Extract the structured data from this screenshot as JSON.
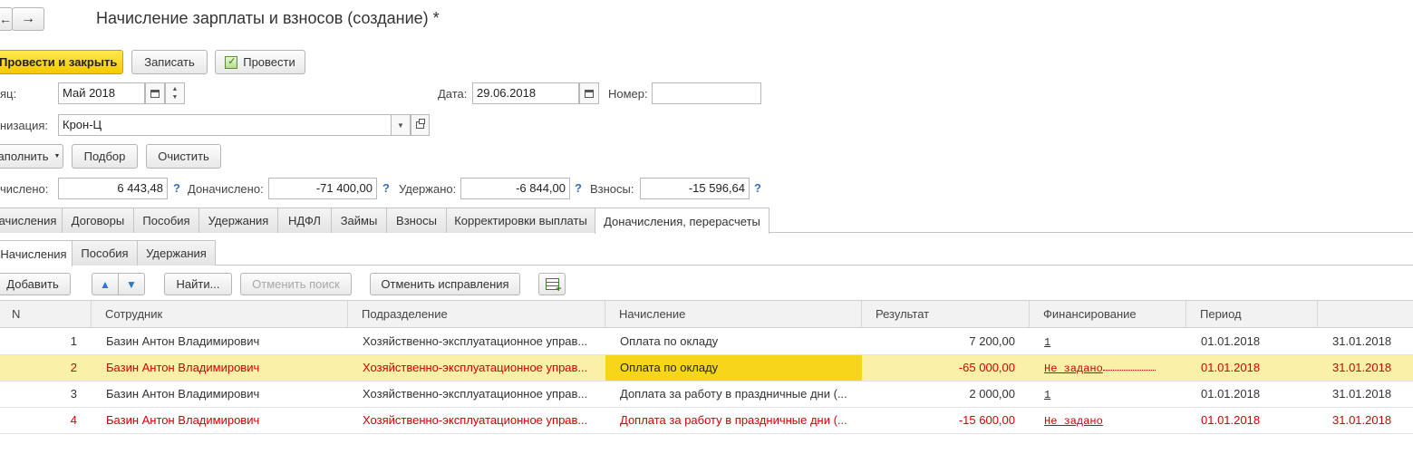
{
  "window": {
    "back_icon": "arrow-left-icon",
    "forward_icon": "arrow-right-icon",
    "title": "Начисление зарплаты и взносов (создание) *"
  },
  "toolbar": {
    "post_close_label": "Провести и закрыть",
    "save_label": "Записать",
    "post_label": "Провести"
  },
  "header": {
    "month_label": "яц:",
    "month_value": "Май 2018",
    "date_label": "Дата:",
    "date_value": "29.06.2018",
    "number_label": "Номер:",
    "number_value": "",
    "org_label": "низация:",
    "org_value": "Крон-Ц"
  },
  "actions": {
    "fill_label": "аполнить",
    "select_label": "Подбор",
    "clear_label": "Очистить"
  },
  "totals": {
    "accrued_label": "числено:",
    "accrued_value": "6 443,48",
    "additional_label": "Доначислено:",
    "additional_value": "-71 400,00",
    "withheld_label": "Удержано:",
    "withheld_value": "-6 844,00",
    "contributions_label": "Взносы:",
    "contributions_value": "-15 596,64",
    "help_mark": "?"
  },
  "tabs": [
    "ачисления",
    "Договоры",
    "Пособия",
    "Удержания",
    "НДФЛ",
    "Займы",
    "Взносы",
    "Корректировки выплаты",
    "Доначисления, перерасчеты"
  ],
  "subtabs": [
    "Начисления",
    "Пособия",
    "Удержания"
  ],
  "grid_toolbar": {
    "add_label": "Добавить",
    "find_label": "Найти...",
    "cancel_search_label": "Отменить поиск",
    "cancel_corrections_label": "Отменить исправления"
  },
  "columns": {
    "n": "N",
    "employee": "Сотрудник",
    "department": "Подразделение",
    "accrual": "Начисление",
    "result": "Результат",
    "financing": "Финансирование",
    "period": "Период"
  },
  "rows": [
    {
      "n": "1",
      "employee": "Базин Антон Владимирович",
      "department": "Хозяйственно-эксплуатационное управ...",
      "accrual": "Оплата по окладу",
      "result": "7 200,00",
      "financing": "1",
      "period_from": "01.01.2018",
      "period_to": "31.01.2018"
    },
    {
      "n": "2",
      "employee": "Базин Антон Владимирович",
      "department": "Хозяйственно-эксплуатационное управ...",
      "accrual": "Оплата по окладу",
      "result": "-65 000,00",
      "financing": "Не задано",
      "period_from": "01.01.2018",
      "period_to": "31.01.2018"
    },
    {
      "n": "3",
      "employee": "Базин Антон Владимирович",
      "department": "Хозяйственно-эксплуатационное управ...",
      "accrual": "Доплата за работу в праздничные дни (...",
      "result": "2 000,00",
      "financing": "1",
      "period_from": "01.01.2018",
      "period_to": "31.01.2018"
    },
    {
      "n": "4",
      "employee": "Базин Антон Владимирович",
      "department": "Хозяйственно-эксплуатационное управ...",
      "accrual": "Доплата за работу в праздничные дни (...",
      "result": "-15 600,00",
      "financing": "Не задано",
      "period_from": "01.01.2018",
      "period_to": "31.01.2018"
    }
  ],
  "colors": {
    "accent_yellow": "#f5c800",
    "selected_row": "#fbf0a8",
    "error_red": "#d40000",
    "help_blue": "#3a6fb5"
  }
}
